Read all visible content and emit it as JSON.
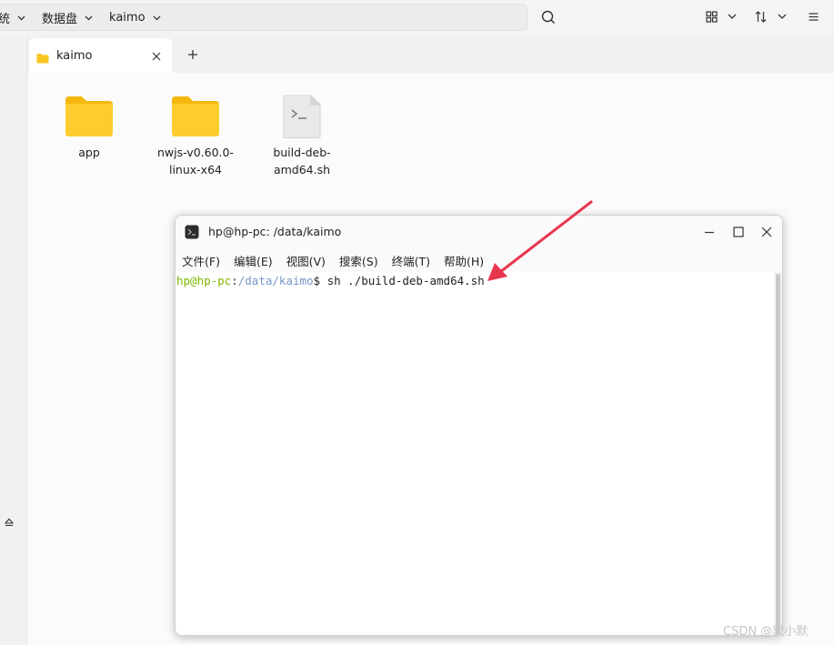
{
  "breadcrumb": {
    "items": [
      {
        "label": "统"
      },
      {
        "label": "数据盘"
      },
      {
        "label": "kaimo"
      }
    ]
  },
  "toolbar": {
    "search_icon": "search-icon",
    "view_icon": "grid-view-icon",
    "sort_icon": "sort-icon",
    "menu_icon": "hamburger-menu-icon"
  },
  "tabs": [
    {
      "label": "kaimo",
      "icon": "folder-icon"
    }
  ],
  "files": [
    {
      "name": "app",
      "type": "folder"
    },
    {
      "name": "nwjs-v0.60.0-linux-x64",
      "type": "folder",
      "line1": "nwjs-v0.60.0-",
      "line2": "linux-x64"
    },
    {
      "name": "build-deb-amd64.sh",
      "type": "script",
      "line1": "build-deb-",
      "line2": "amd64.sh"
    }
  ],
  "terminal": {
    "title": "hp@hp-pc: /data/kaimo",
    "menu": [
      "文件(F)",
      "编辑(E)",
      "视图(V)",
      "搜索(S)",
      "终端(T)",
      "帮助(H)"
    ],
    "prompt": {
      "user_host": "hp@hp-pc",
      "colon": ":",
      "path": "/data/kaimo",
      "symbol": "$",
      "command": " sh ./build-deb-amd64.sh"
    }
  },
  "colors": {
    "folder": "#f9c521",
    "prompt_user": "#7fb800",
    "prompt_path": "#7497c6",
    "arrow": "#e8364d"
  },
  "watermark": "CSDN @凯小默"
}
